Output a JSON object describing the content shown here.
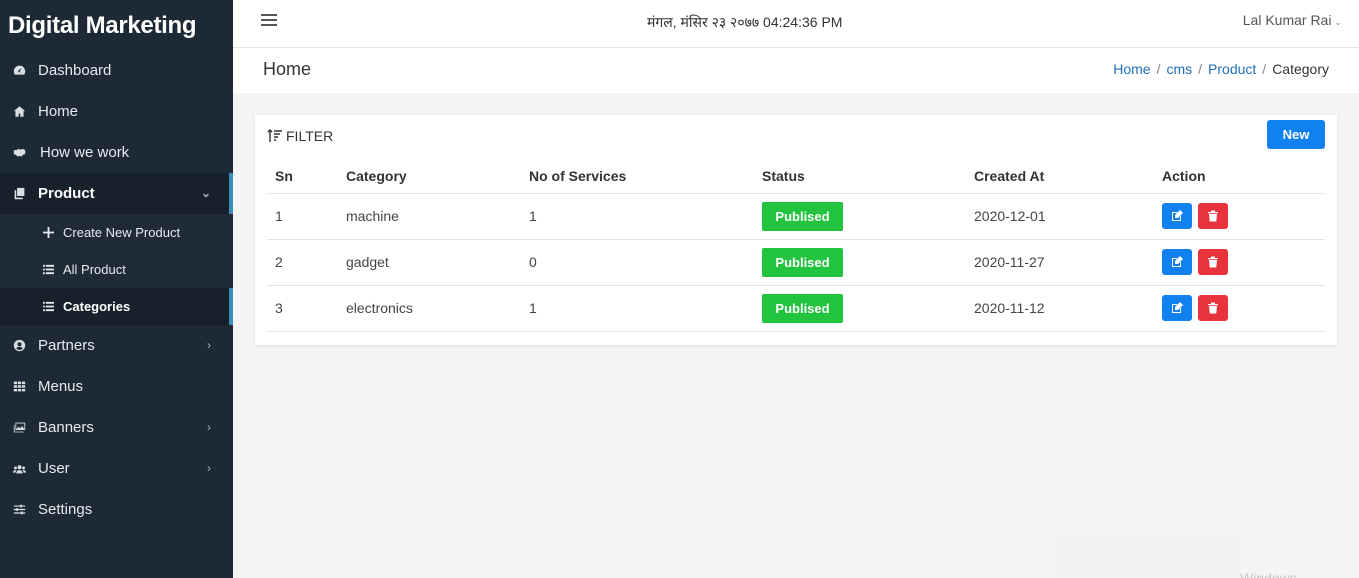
{
  "sidebar": {
    "brand": "Digital Marketing",
    "items": [
      {
        "label": "Dashboard",
        "icon": "dashboard-icon"
      },
      {
        "label": "Home",
        "icon": "home-icon"
      },
      {
        "label": "How we work",
        "icon": "handshake-icon"
      },
      {
        "label": "Product",
        "icon": "copy-icon",
        "expanded": true
      },
      {
        "label": "Partners",
        "icon": "user-circle-icon"
      },
      {
        "label": "Menus",
        "icon": "grid-icon"
      },
      {
        "label": "Banners",
        "icon": "images-icon"
      },
      {
        "label": "User",
        "icon": "users-icon"
      },
      {
        "label": "Settings",
        "icon": "sliders-icon"
      }
    ],
    "product_sub": [
      {
        "label": "Create New Product",
        "icon": "plus-icon"
      },
      {
        "label": "All Product",
        "icon": "list-icon"
      },
      {
        "label": "Categories",
        "icon": "list-icon",
        "active": true
      }
    ]
  },
  "topbar": {
    "datetime": "मंगल, मंसिर २३ २०७७ 04:24:36 PM",
    "user": "Lal Kumar Rai"
  },
  "page": {
    "title": "Home",
    "breadcrumb": [
      "Home",
      "cms",
      "Product",
      "Category"
    ]
  },
  "card": {
    "filter_label": "FILTER",
    "new_button": "New",
    "columns": [
      "Sn",
      "Category",
      "No of Services",
      "Status",
      "Created At",
      "Action"
    ],
    "rows": [
      {
        "sn": "1",
        "category": "machine",
        "services": "1",
        "status": "Publised",
        "created": "2020-12-01"
      },
      {
        "sn": "2",
        "category": "gadget",
        "services": "0",
        "status": "Publised",
        "created": "2020-11-27"
      },
      {
        "sn": "3",
        "category": "electronics",
        "services": "1",
        "status": "Publised",
        "created": "2020-11-12"
      }
    ]
  },
  "colors": {
    "sidebar_bg": "#1d2a36",
    "accent_blue": "#1281f0",
    "status_green": "#22c33e",
    "delete_red": "#e8323c",
    "active_indicator": "#3c8dbc"
  },
  "watermark": "Windows"
}
